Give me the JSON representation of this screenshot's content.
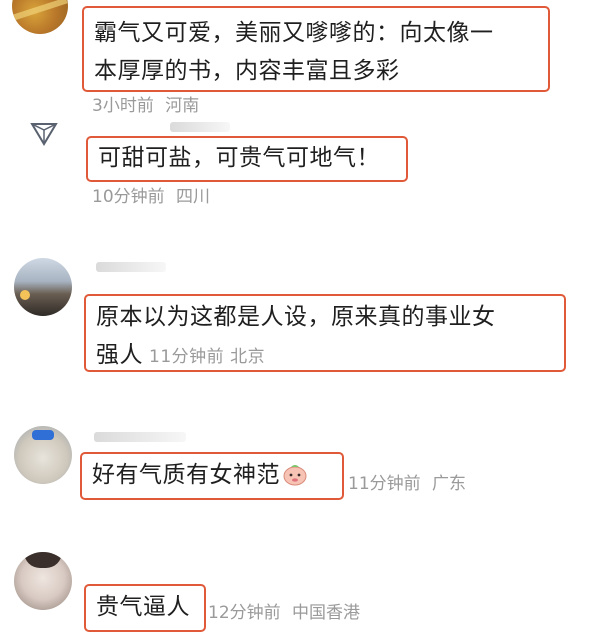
{
  "comments": [
    {
      "text": "霸气又可爱，美丽又嗲嗲的：向太像一本厚厚的书，内容丰富且多彩",
      "line1": "霸气又可爱，美丽又嗲嗲的：向太像一",
      "line2": "本厚厚的书，内容丰富且多彩",
      "time": "3小时前",
      "location": "河南"
    },
    {
      "text": "可甜可盐，可贵气可地气！",
      "time": "10分钟前",
      "location": "四川"
    },
    {
      "text": "原本以为这都是人设，原来真的事业女强人",
      "line1": "原本以为这都是人设，原来真的事业女",
      "line2": "强人",
      "time": "11分钟前",
      "location": "北京"
    },
    {
      "text": "好有气质有女神范",
      "emoji": "peach-blush-emoji",
      "time": "11分钟前",
      "location": "广东"
    },
    {
      "text": "贵气逼人",
      "time": "12分钟前",
      "location": "中国香港"
    }
  ],
  "highlight_color": "#e05a3a",
  "meta_color": "#9a9a9a"
}
